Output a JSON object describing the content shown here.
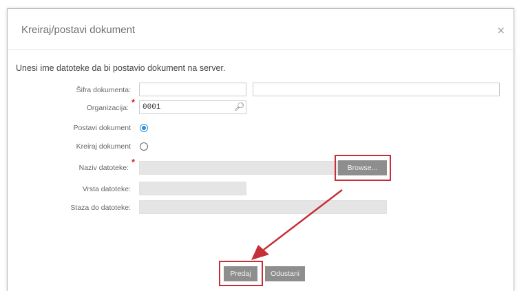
{
  "dialog": {
    "title": "Kreiraj/postavi dokument",
    "close_glyph": "×",
    "intro": "Unesi ime datoteke da bi postavio dokument na server."
  },
  "form": {
    "sifra_label": "Šifra dokumenta:",
    "sifra_value": "",
    "sifra_description": "",
    "organizacija_label": "Organizacija:",
    "organizacija_value": "0001",
    "postavi_label": "Postavi dokument",
    "postavi_selected": true,
    "kreiraj_label": "Kreiraj dokument",
    "kreiraj_selected": false,
    "naziv_label": "Naziv datoteke:",
    "naziv_value": "",
    "browse_label": "Browse...",
    "vrsta_label": "Vrsta datoteke:",
    "vrsta_value": "",
    "staza_label": "Staza do datoteke:",
    "staza_value": ""
  },
  "footer": {
    "submit_label": "Predaj",
    "cancel_label": "Odustani"
  },
  "icons": {
    "lookup": "magnifier-icon",
    "close": "close-icon"
  },
  "colors": {
    "required_marker": "#d81e1e",
    "radio_selected": "#2a8de0",
    "highlight_annotation": "#c62f37",
    "button_bg": "#8e8e8e"
  }
}
